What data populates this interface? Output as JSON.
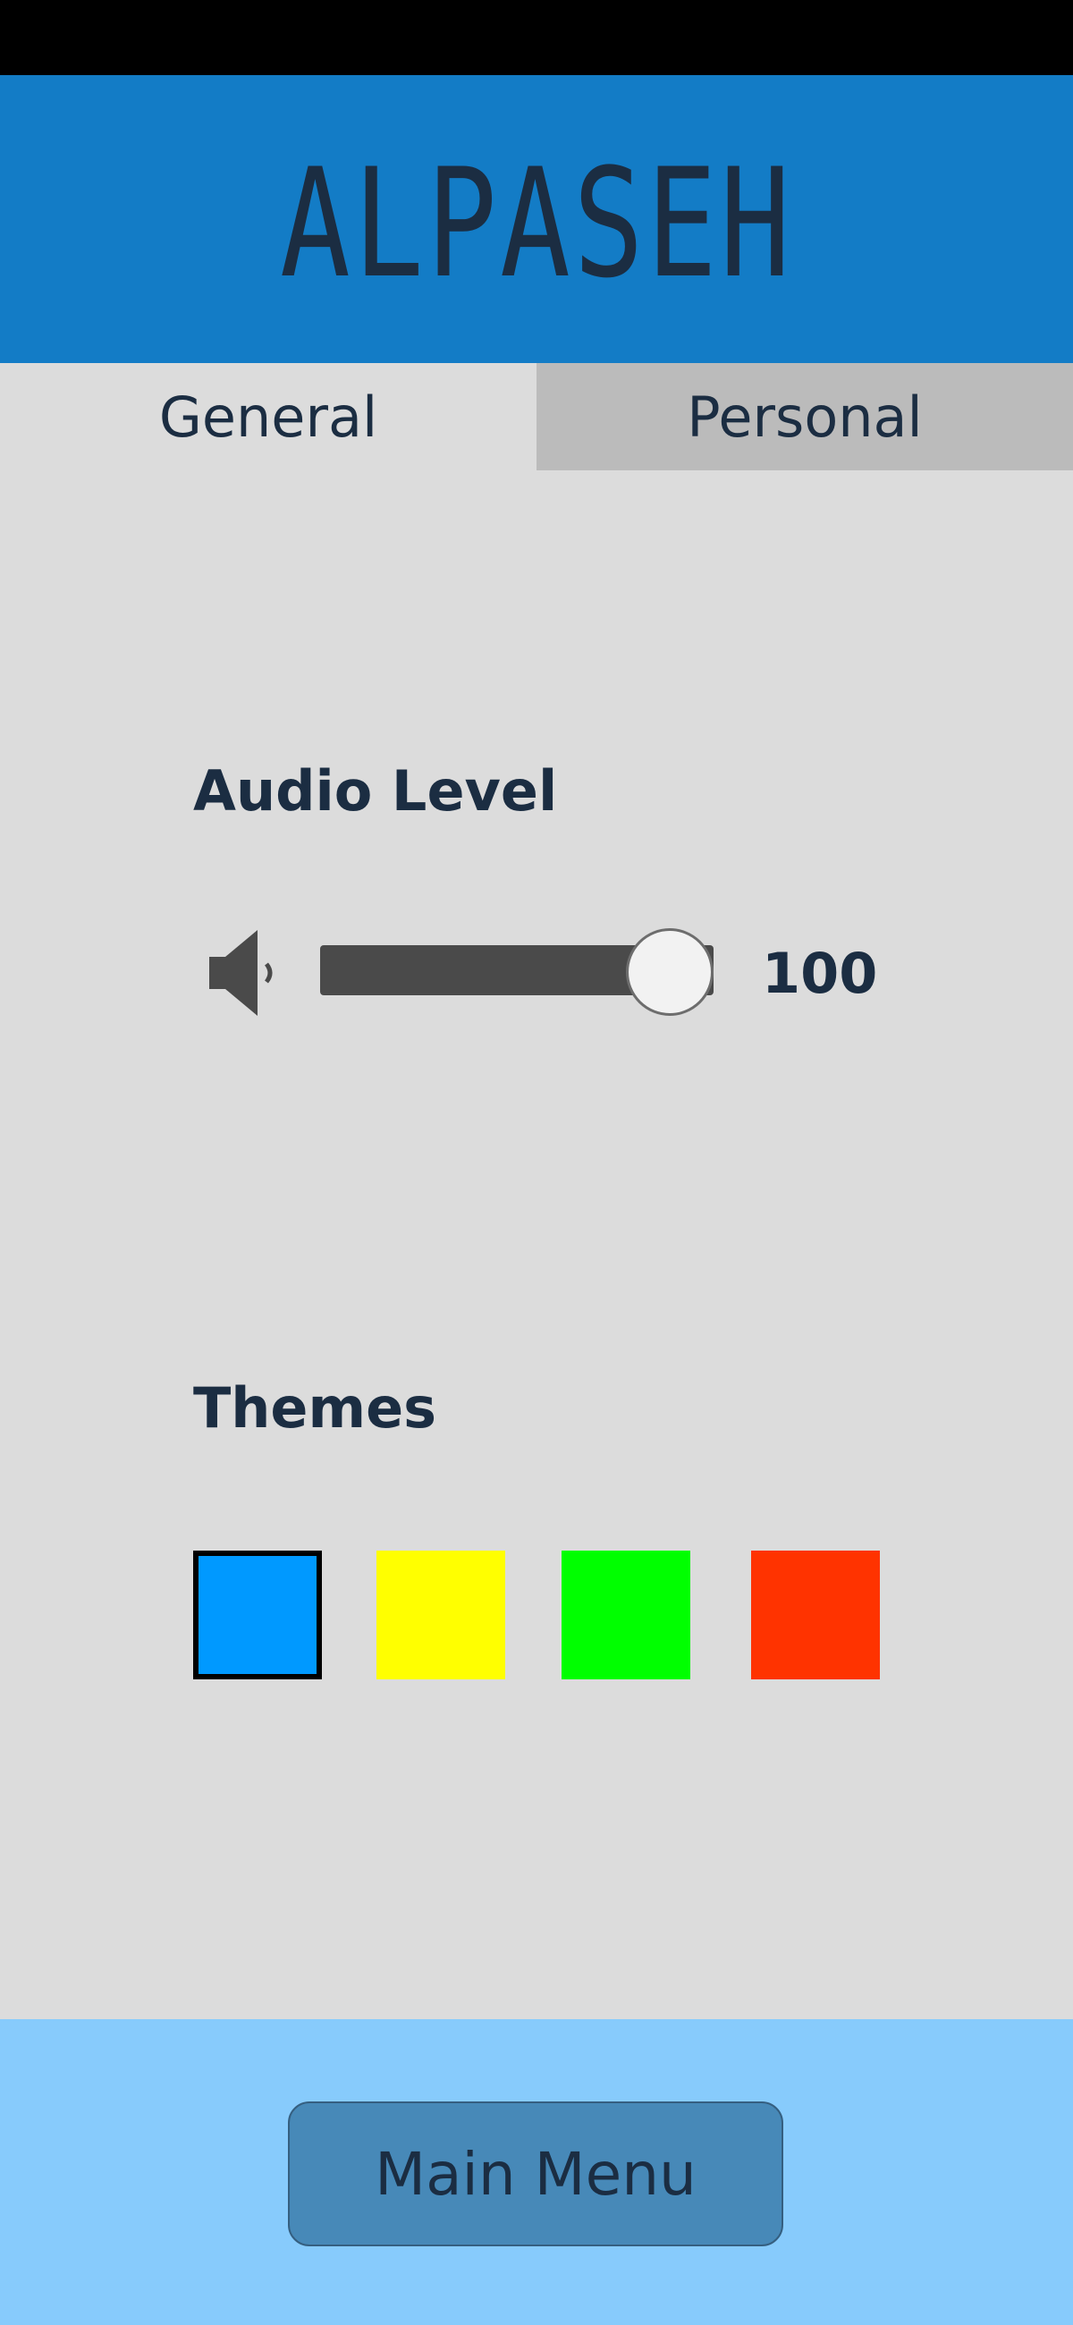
{
  "app": {
    "title": "ALPASEH"
  },
  "tabs": [
    {
      "label": "General",
      "active": true
    },
    {
      "label": "Personal",
      "active": false
    }
  ],
  "audio": {
    "title": "Audio Level",
    "icon": "speaker-icon",
    "value": 100,
    "value_label": "100",
    "min": 0,
    "max": 100
  },
  "themes": {
    "title": "Themes",
    "swatches": [
      {
        "color": "#0099ff",
        "selected": true
      },
      {
        "color": "#ffff00",
        "selected": false
      },
      {
        "color": "#00ff00",
        "selected": false
      },
      {
        "color": "#ff3300",
        "selected": false
      }
    ]
  },
  "footer": {
    "main_menu_label": "Main Menu"
  },
  "colors": {
    "header_bg": "#137cc6",
    "body_bg": "#dcdcdc",
    "inactive_tab_bg": "#bbbbbb",
    "footer_bg": "#87cbfc",
    "button_bg": "#4789b8",
    "text": "#1b2d42"
  }
}
